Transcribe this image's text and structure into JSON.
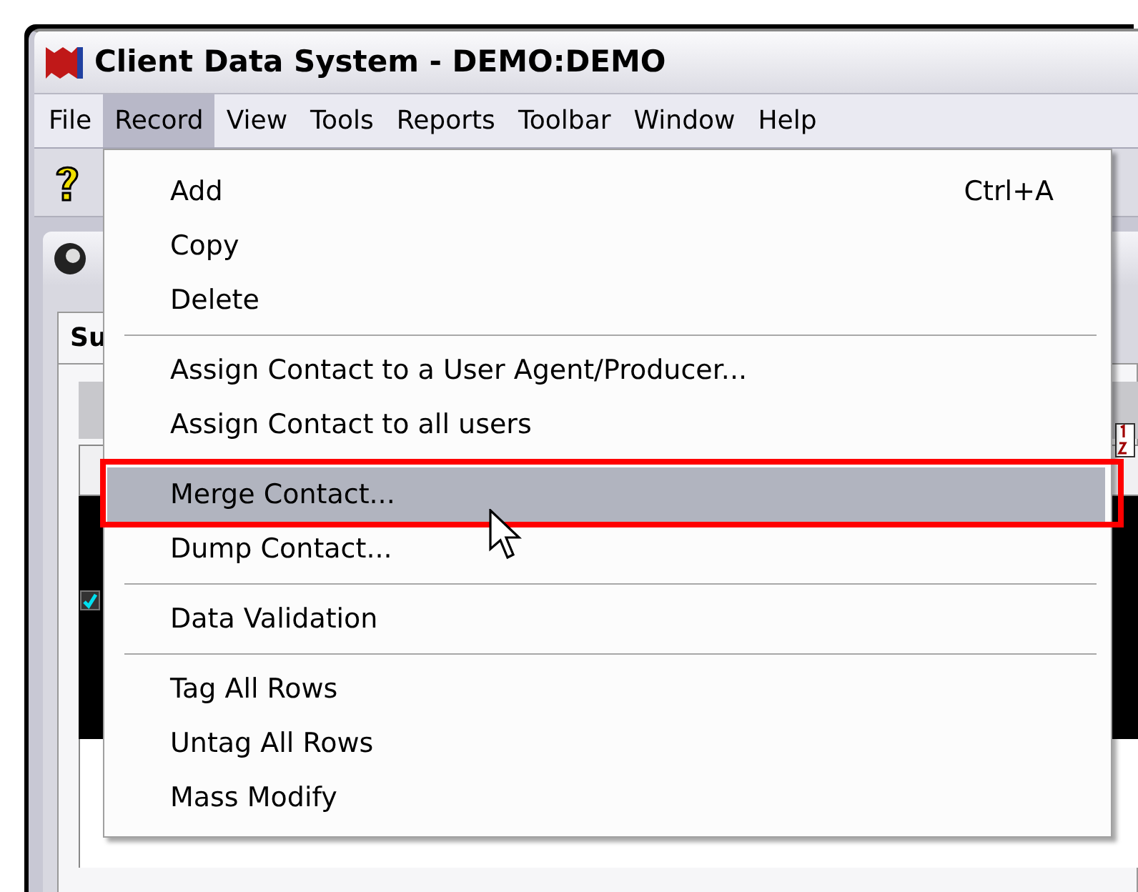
{
  "window": {
    "title": "Client Data System - DEMO:DEMO"
  },
  "menu_bar": [
    {
      "label": "File",
      "selected": false
    },
    {
      "label": "Record",
      "selected": true
    },
    {
      "label": "View",
      "selected": false
    },
    {
      "label": "Tools",
      "selected": false
    },
    {
      "label": "Reports",
      "selected": false
    },
    {
      "label": "Toolbar",
      "selected": false
    },
    {
      "label": "Window",
      "selected": false
    },
    {
      "label": "Help",
      "selected": false
    }
  ],
  "document": {
    "tab": "Su"
  },
  "dropdown": {
    "items": [
      {
        "kind": "item",
        "label": "Add",
        "shortcut": "Ctrl+A",
        "selected": false
      },
      {
        "kind": "item",
        "label": "Copy",
        "selected": false
      },
      {
        "kind": "item",
        "label": "Delete",
        "selected": false
      },
      {
        "kind": "separator"
      },
      {
        "kind": "item",
        "label": "Assign Contact to a User Agent/Producer...",
        "selected": false
      },
      {
        "kind": "item",
        "label": "Assign Contact to all users",
        "selected": false
      },
      {
        "kind": "separator"
      },
      {
        "kind": "item",
        "label": "Merge Contact...",
        "selected": true,
        "annotated": true
      },
      {
        "kind": "item",
        "label": "Dump Contact...",
        "selected": false
      },
      {
        "kind": "separator"
      },
      {
        "kind": "item",
        "label": "Data Validation",
        "selected": false
      },
      {
        "kind": "separator"
      },
      {
        "kind": "item",
        "label": "Tag All Rows",
        "selected": false
      },
      {
        "kind": "item",
        "label": "Untag All Rows",
        "selected": false
      },
      {
        "kind": "item",
        "label": "Mass Modify",
        "selected": false
      }
    ]
  }
}
